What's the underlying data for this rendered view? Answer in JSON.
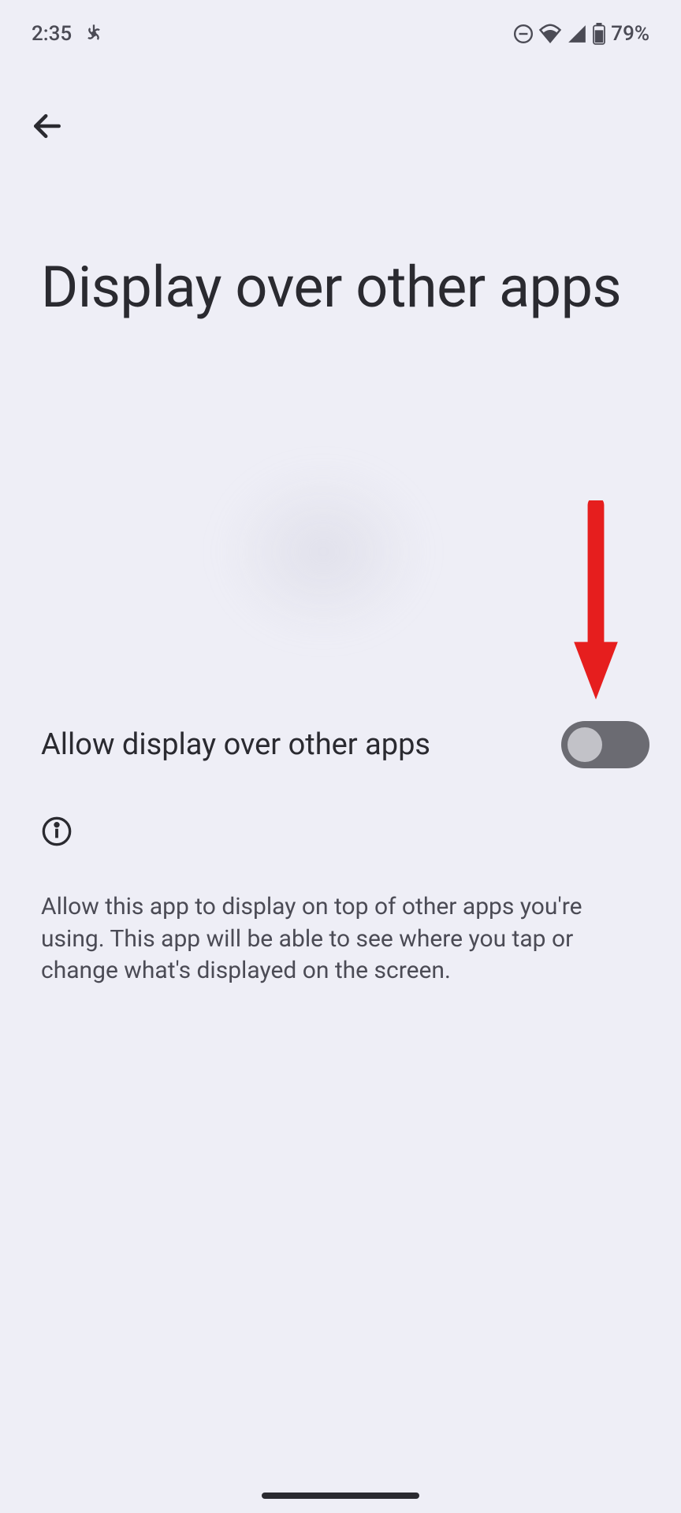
{
  "statusBar": {
    "time": "2:35",
    "batteryPercent": "79%"
  },
  "pageTitle": "Display over other apps",
  "setting": {
    "label": "Allow display over other apps",
    "enabled": false
  },
  "infoText": "Allow this app to display on top of other apps you're using. This app will be able to see where you tap or change what's displayed on the screen."
}
